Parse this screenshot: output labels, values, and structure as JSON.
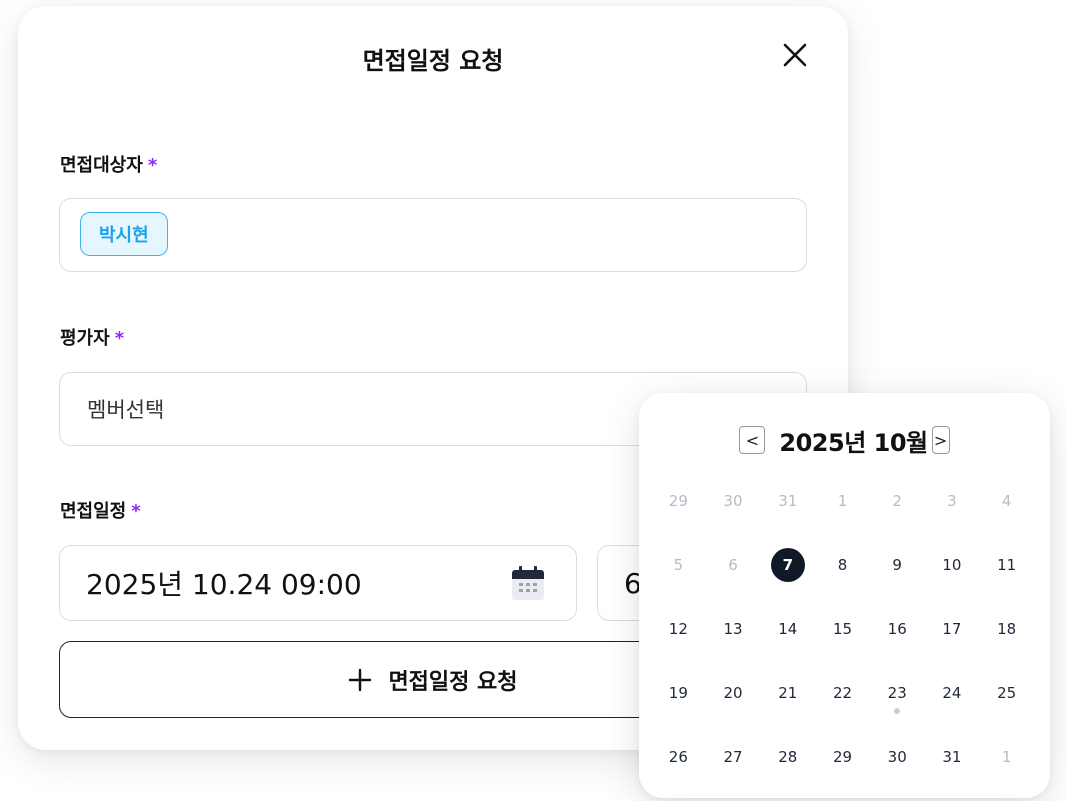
{
  "modal": {
    "title": "면접일정 요청",
    "candidate": {
      "label": "면접대상자",
      "required_mark": "*",
      "chip": "박시현"
    },
    "evaluator": {
      "label": "평가자",
      "required_mark": "*",
      "placeholder": "멤버선택"
    },
    "schedule": {
      "label": "면접일정",
      "required_mark": "*",
      "datetime_value": "2025년 10.24 09:00",
      "duration_value": "6",
      "icon": "calendar-icon"
    },
    "add_button": {
      "icon": "plus-icon",
      "label": "면접일정 요청"
    },
    "close_icon": "close-icon"
  },
  "calendar": {
    "month_label": "2025년 10월",
    "prev_label": "<",
    "next_label": ">",
    "weeks": [
      [
        {
          "d": "29",
          "muted": true
        },
        {
          "d": "30",
          "muted": true
        },
        {
          "d": "31",
          "muted": true
        },
        {
          "d": "1",
          "muted": true
        },
        {
          "d": "2",
          "muted": true
        },
        {
          "d": "3",
          "muted": true
        },
        {
          "d": "4",
          "muted": true
        }
      ],
      [
        {
          "d": "5",
          "muted": true
        },
        {
          "d": "6",
          "muted": true
        },
        {
          "d": "7",
          "selected": true
        },
        {
          "d": "8"
        },
        {
          "d": "9"
        },
        {
          "d": "10"
        },
        {
          "d": "11"
        }
      ],
      [
        {
          "d": "12"
        },
        {
          "d": "13"
        },
        {
          "d": "14"
        },
        {
          "d": "15"
        },
        {
          "d": "16"
        },
        {
          "d": "17"
        },
        {
          "d": "18"
        }
      ],
      [
        {
          "d": "19"
        },
        {
          "d": "20"
        },
        {
          "d": "21"
        },
        {
          "d": "22"
        },
        {
          "d": "23",
          "dot": true
        },
        {
          "d": "24"
        },
        {
          "d": "25"
        }
      ],
      [
        {
          "d": "26"
        },
        {
          "d": "27"
        },
        {
          "d": "28"
        },
        {
          "d": "29"
        },
        {
          "d": "30"
        },
        {
          "d": "31"
        },
        {
          "d": "1",
          "muted": true
        }
      ]
    ]
  },
  "colors": {
    "required": "#8b2cf5",
    "chip_text": "#1aa3ea",
    "chip_bg": "#e6f6ff",
    "selected_day": "#111827"
  }
}
